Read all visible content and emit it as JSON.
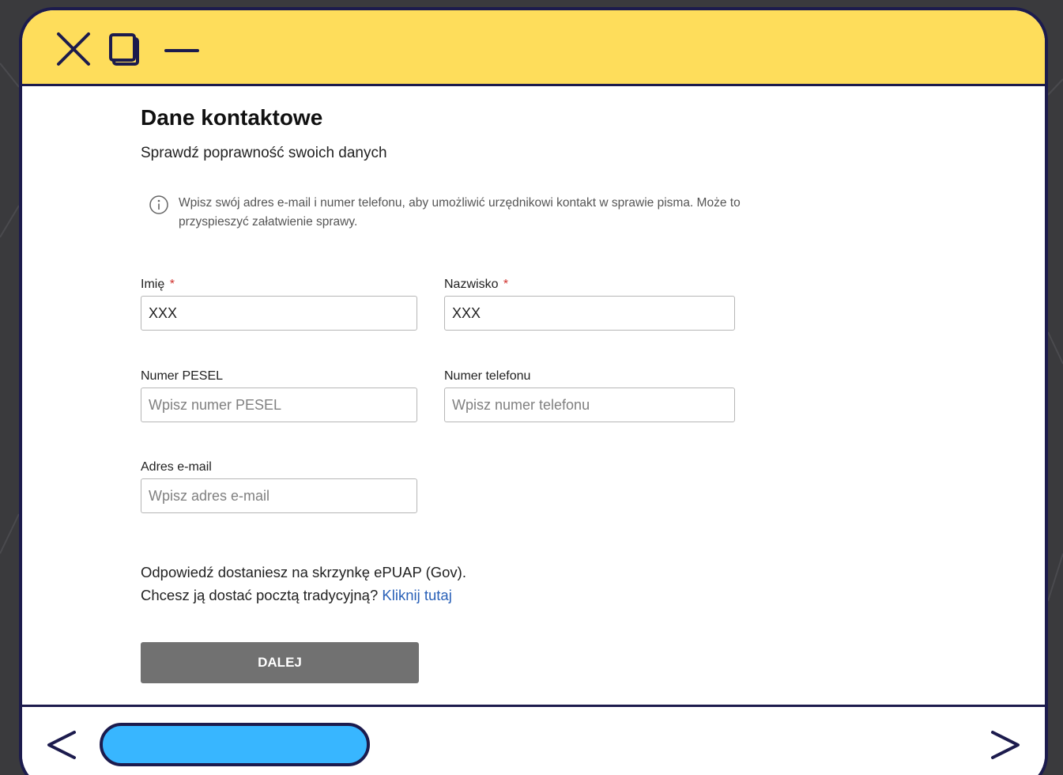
{
  "colors": {
    "titlebar": "#fedd5b",
    "frame": "#1c1b4d",
    "address_bar": "#38b6ff",
    "button": "#717171",
    "link": "#2a61b8",
    "required": "#d0312d"
  },
  "window_controls": {
    "close_icon": "close-icon",
    "maximize_icon": "maximize-icon",
    "minimize_icon": "minimize-icon"
  },
  "form": {
    "title": "Dane kontaktowe",
    "subtitle": "Sprawdź poprawność swoich danych",
    "info": "Wpisz swój adres e-mail i numer telefonu, aby umożliwić urzędnikowi kontakt w sprawie pisma. Może to przyspieszyć załatwienie sprawy.",
    "required_mark": "*",
    "first_name": {
      "label": "Imię",
      "value": "XXX"
    },
    "last_name": {
      "label": "Nazwisko",
      "value": "XXX"
    },
    "pesel": {
      "label": "Numer PESEL",
      "placeholder": "Wpisz numer PESEL"
    },
    "phone": {
      "label": "Numer telefonu",
      "placeholder": "Wpisz numer telefonu"
    },
    "email": {
      "label": "Adres e-mail",
      "placeholder": "Wpisz adres e-mail"
    },
    "reply_line1": "Odpowiedź dostaniesz na skrzynkę ePUAP (Gov).",
    "reply_line2": "Chcesz ją dostać pocztą tradycyjną?",
    "reply_link": "Kliknij tutaj",
    "next_button": "DALEJ"
  },
  "navigation": {
    "back_icon": "chevron-left-icon",
    "forward_icon": "chevron-right-icon"
  }
}
